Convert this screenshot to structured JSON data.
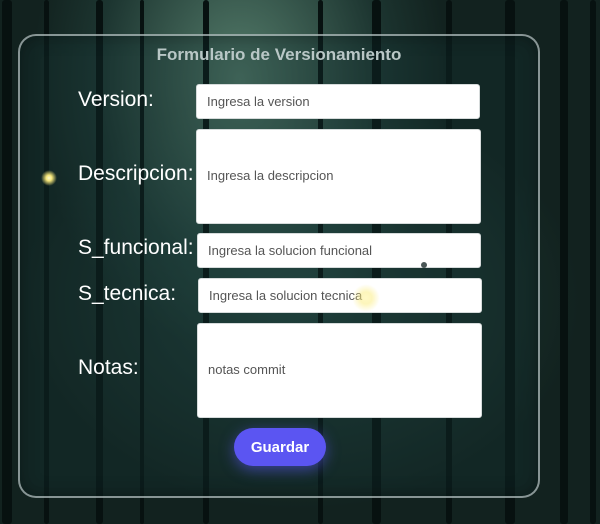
{
  "form": {
    "title": "Formulario de Versionamiento",
    "fields": [
      {
        "label": "Version:",
        "placeholder": "Ingresa la version"
      },
      {
        "label": "Descripcion:",
        "placeholder": "Ingresa la descripcion"
      },
      {
        "label": "S_funcional:",
        "placeholder": "Ingresa la solucion funcional"
      },
      {
        "label": "S_tecnica:",
        "placeholder": "Ingresa la solucion tecnica"
      },
      {
        "label": "Notas:",
        "placeholder": "notas commit"
      }
    ],
    "submit_label": "Guardar"
  },
  "colors": {
    "accent": "#5b55f2",
    "panel_border": "#c8d2d2",
    "background": "#12221f"
  }
}
